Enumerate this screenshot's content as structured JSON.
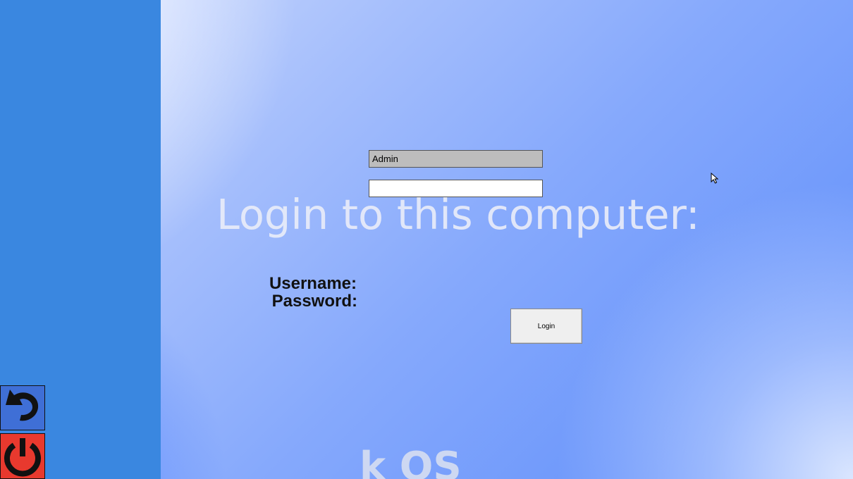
{
  "login": {
    "title": "Login to this computer:",
    "username_label": "Username:",
    "password_label": "Password:",
    "username_value": "Admin",
    "password_value": "",
    "login_button": "Login"
  },
  "os_name": "k OS",
  "sidebar": {
    "restart_icon": "restart-icon",
    "power_icon": "power-icon"
  },
  "colors": {
    "sidebar": "#3a87e0",
    "power_button": "#e8392e",
    "restart_button": "#3f6fd6"
  }
}
